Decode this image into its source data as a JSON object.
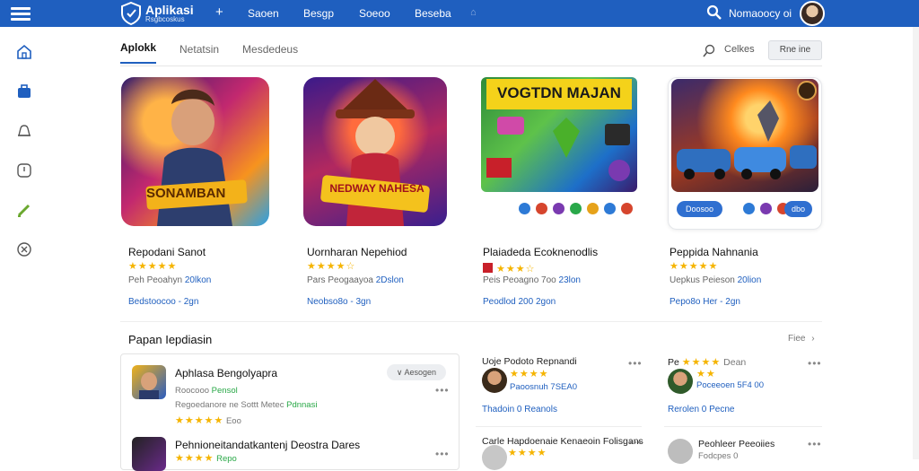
{
  "header": {
    "logo_title": "Aplikasi",
    "logo_sub": "Rsgbcoskus",
    "plus": "+",
    "nav": [
      "Saoen",
      "Besgp",
      "Soeoo",
      "Beseba"
    ],
    "nav_dim": "⌂",
    "user_name": "Nomaoocy oi"
  },
  "tabs": {
    "items": [
      "Aplokk",
      "Netatsin",
      "Mesdedeus"
    ],
    "search_text": "Celkes",
    "filter_label": "Rne ine"
  },
  "games": [
    {
      "title": "Repodani Sanot",
      "logo_text": "SONAMBAN",
      "stars": "★★★★★",
      "meta_prefix": "Peh Peoahyn",
      "meta_value": "20lkon",
      "link": "Bedstoocoo - 2gn"
    },
    {
      "title": "Uornharan Nepehiod",
      "logo_text": "NEDWAY NAHESA",
      "stars": "★★★★☆",
      "meta_prefix": "Pars Peogaayoa",
      "meta_value": "2Dslon",
      "link": "Neobso8o - 3gn"
    },
    {
      "title": "Plaiadeda Ecoknenodlis",
      "logo_text": "VOGTDN MAJAN",
      "stars": "★★★☆",
      "meta_prefix": "Peis Peoagno 7oo",
      "meta_value": "23lon",
      "link": "Peodlod 200 2gon"
    },
    {
      "title": "Peppida Nahnania",
      "badge_label": "Doosoo",
      "badge2_label": "dbo",
      "stars": "★★★★★",
      "meta_prefix": "Uepkus Peieson",
      "meta_value": "20lion",
      "link": "Pepo8o Her - 2gn"
    }
  ],
  "section": {
    "title": "Papan Iepdiasin",
    "more": "Fiee"
  },
  "list": [
    {
      "title": "Aphlasa Bengolyapra",
      "sub1_prefix": "Roocooo",
      "sub1_tag": "Pensol",
      "sub2_prefix": "Regoedanore ne Sottt Metec",
      "sub2_tag": "Pdnnasi",
      "stars": "★★★★★",
      "stars_note": "Eoo",
      "badge": "Aesogen"
    },
    {
      "title": "Pehnioneitandatkantenj Deostra Dares",
      "stars": "★★★★",
      "stars_note": "Repo"
    }
  ],
  "col2": [
    {
      "title": "Uoje Podoto Repnandi",
      "stars": "★★★★",
      "blue": "Paoosnuh 7SEA0"
    },
    {
      "link": "Thadoin 0 Reanols"
    },
    {
      "title": "Carle Hapdoenaie Kenaeoin Folisgans"
    }
  ],
  "col3": [
    {
      "title_prefix": "Pe",
      "stars": "★★★★",
      "title_suffix": "Dean",
      "stars2": "★★",
      "blue": "Poceeoen 5F4 00"
    },
    {
      "link": "Rerolen 0 Pecne"
    },
    {
      "title": "Peohleer Peeoiies",
      "blue": "Fodcpes 0"
    }
  ],
  "colors": {
    "accent": "#1f5fbf",
    "star": "#f5b400",
    "ok": "#29a847"
  },
  "icons": {
    "rail": [
      "home-icon",
      "apps-icon",
      "bell-icon",
      "clock-icon",
      "pen-icon",
      "settings-icon"
    ]
  }
}
